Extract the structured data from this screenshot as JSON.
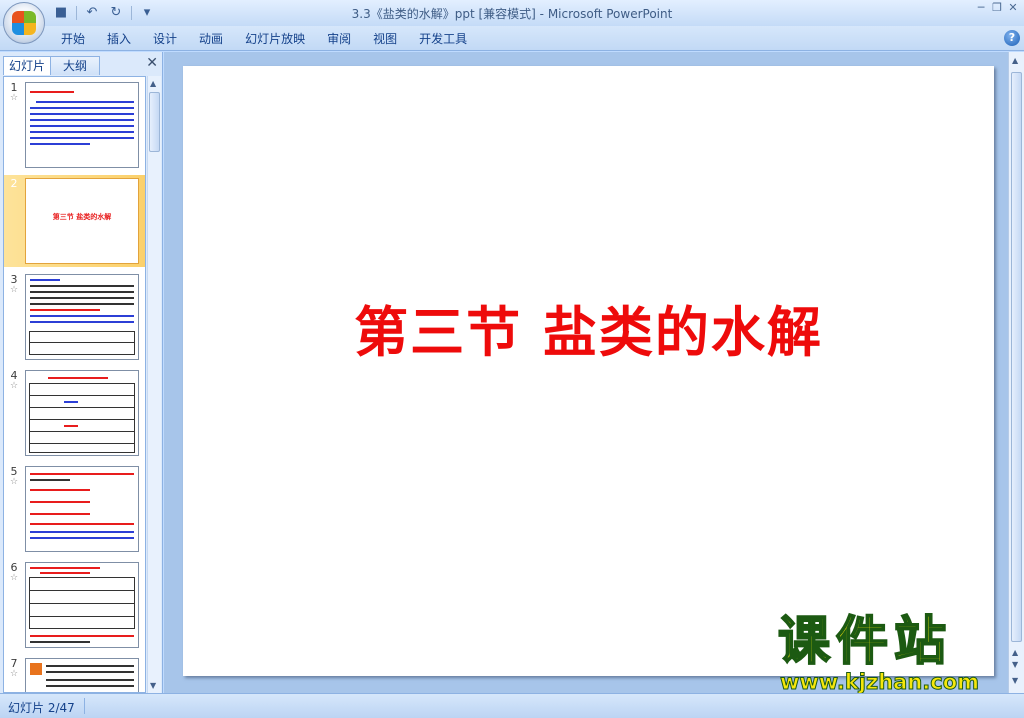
{
  "window": {
    "title": "3.3《盐类的水解》ppt [兼容模式] - Microsoft PowerPoint",
    "minimize": "─",
    "restore": "❐",
    "close": "✕"
  },
  "quick_access": {
    "save_icon": "■",
    "undo_icon": "↶",
    "redo_icon": "↻",
    "customize_icon": "▾"
  },
  "ribbon": {
    "tabs": [
      "开始",
      "插入",
      "设计",
      "动画",
      "幻灯片放映",
      "审阅",
      "视图",
      "开发工具"
    ],
    "help": "?"
  },
  "panel": {
    "tab_slides": "幻灯片",
    "tab_outline": "大纲",
    "close": "✕"
  },
  "thumbnails": [
    {
      "number": "1",
      "star": "☆"
    },
    {
      "number": "2",
      "star": "☆",
      "title": "第三节  盐类的水解"
    },
    {
      "number": "3",
      "star": "☆"
    },
    {
      "number": "4",
      "star": "☆"
    },
    {
      "number": "5",
      "star": "☆"
    },
    {
      "number": "6",
      "star": "☆"
    },
    {
      "number": "7",
      "star": "☆"
    }
  ],
  "slide": {
    "title": "第三节  盐类的水解"
  },
  "watermark": {
    "brand": "课件站",
    "url": "www.kjzhan.com"
  },
  "status": {
    "slide_counter": "幻灯片 2/47"
  }
}
